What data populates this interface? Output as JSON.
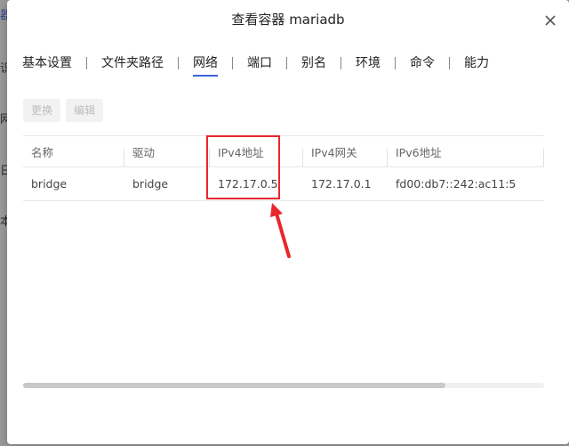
{
  "background": {
    "fragments": [
      "器",
      "识",
      "网",
      "日",
      "本"
    ]
  },
  "modal": {
    "title": "查看容器 mariadb"
  },
  "tabs": [
    {
      "label": "基本设置",
      "active": false
    },
    {
      "label": "文件夹路径",
      "active": false
    },
    {
      "label": "网络",
      "active": true
    },
    {
      "label": "端口",
      "active": false
    },
    {
      "label": "别名",
      "active": false
    },
    {
      "label": "环境",
      "active": false
    },
    {
      "label": "命令",
      "active": false
    },
    {
      "label": "能力",
      "active": false
    }
  ],
  "toolbar": {
    "replace_label": "更换",
    "edit_label": "编辑"
  },
  "table": {
    "headers": [
      "名称",
      "驱动",
      "IPv4地址",
      "IPv4网关",
      "IPv6地址"
    ],
    "rows": [
      [
        "bridge",
        "bridge",
        "172.17.0.5",
        "172.17.0.1",
        "fd00:db7::242:ac11:5"
      ]
    ]
  },
  "colors": {
    "accent": "#3a62e0",
    "highlight": "#e8262c"
  },
  "scroll": {
    "horizontal_fraction_visible": 0.81
  }
}
